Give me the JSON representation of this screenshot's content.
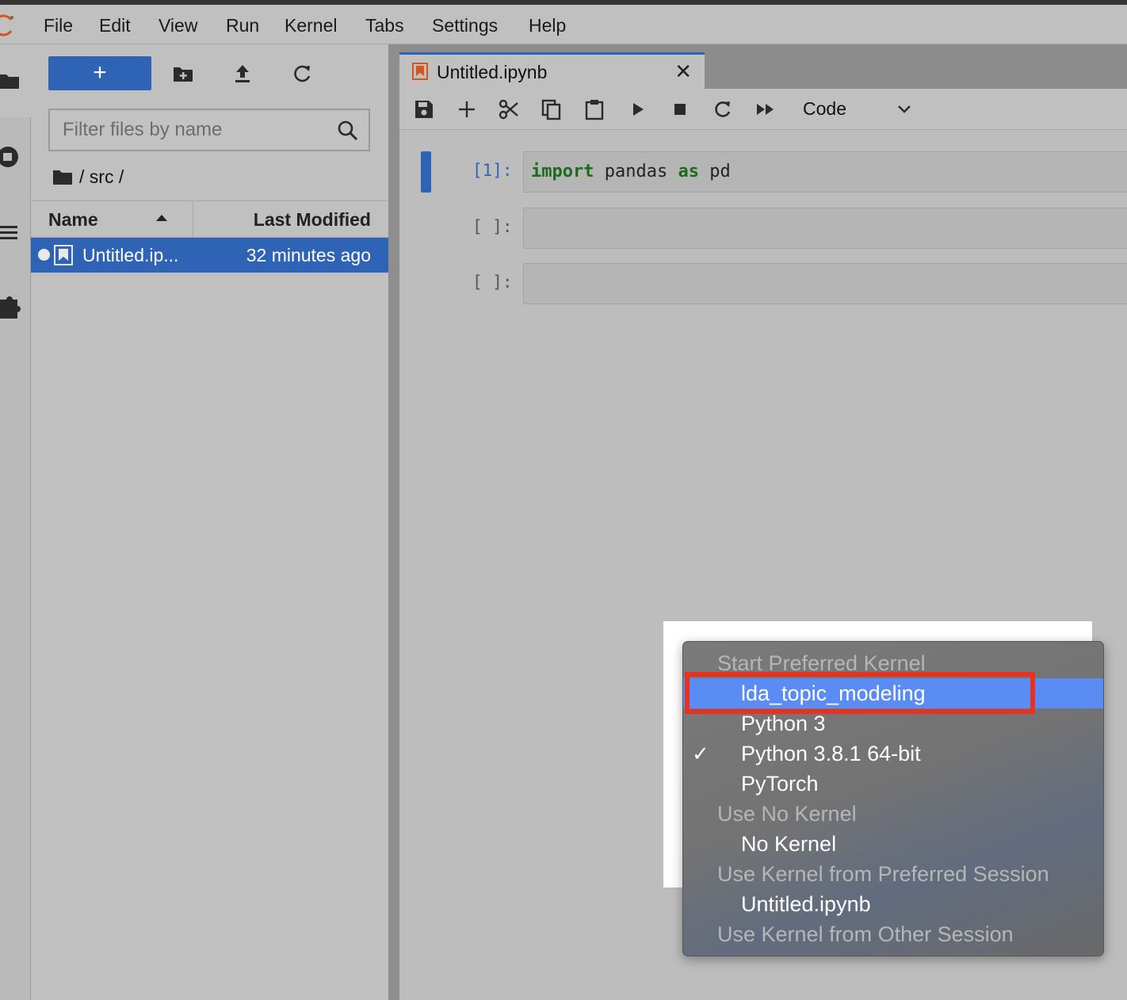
{
  "menubar": {
    "items": [
      "File",
      "Edit",
      "View",
      "Run",
      "Kernel",
      "Tabs",
      "Settings",
      "Help"
    ]
  },
  "file_browser": {
    "new_button_label": "+",
    "filter_placeholder": "Filter files by name",
    "breadcrumb": "/ src /",
    "columns": {
      "name": "Name",
      "last_modified": "Last Modified"
    },
    "files": [
      {
        "name": "Untitled.ip...",
        "modified": "32 minutes ago"
      }
    ]
  },
  "notebook": {
    "tab_title": "Untitled.ipynb",
    "tab_close": "✕",
    "cell_type": "Code",
    "cells": [
      {
        "prompt": "[1]:",
        "code_kw1": "import",
        "code_mid": " pandas ",
        "code_kw2": "as",
        "code_end": " pd"
      },
      {
        "prompt": "[ ]:"
      },
      {
        "prompt": "[ ]:"
      }
    ]
  },
  "kernel_dropdown": {
    "check_mark": "✓",
    "options": [
      {
        "label": "Start Preferred Kernel",
        "kind": "group"
      },
      {
        "label": "lda_topic_modeling",
        "kind": "item",
        "selected": true
      },
      {
        "label": "Python 3",
        "kind": "item"
      },
      {
        "label": "Python 3.8.1 64-bit",
        "kind": "item",
        "checked": true
      },
      {
        "label": "PyTorch",
        "kind": "item"
      },
      {
        "label": "Use No Kernel",
        "kind": "group"
      },
      {
        "label": "No Kernel",
        "kind": "item"
      },
      {
        "label": "Use Kernel from Preferred Session",
        "kind": "group"
      },
      {
        "label": "Untitled.ipynb",
        "kind": "item"
      },
      {
        "label": "Use Kernel from Other Session",
        "kind": "group"
      }
    ]
  },
  "colors": {
    "accent": "#2f63b5",
    "selected_option": "#5b8cf3",
    "highlight_box": "#e53222",
    "keyword": "#1c6b1c"
  }
}
